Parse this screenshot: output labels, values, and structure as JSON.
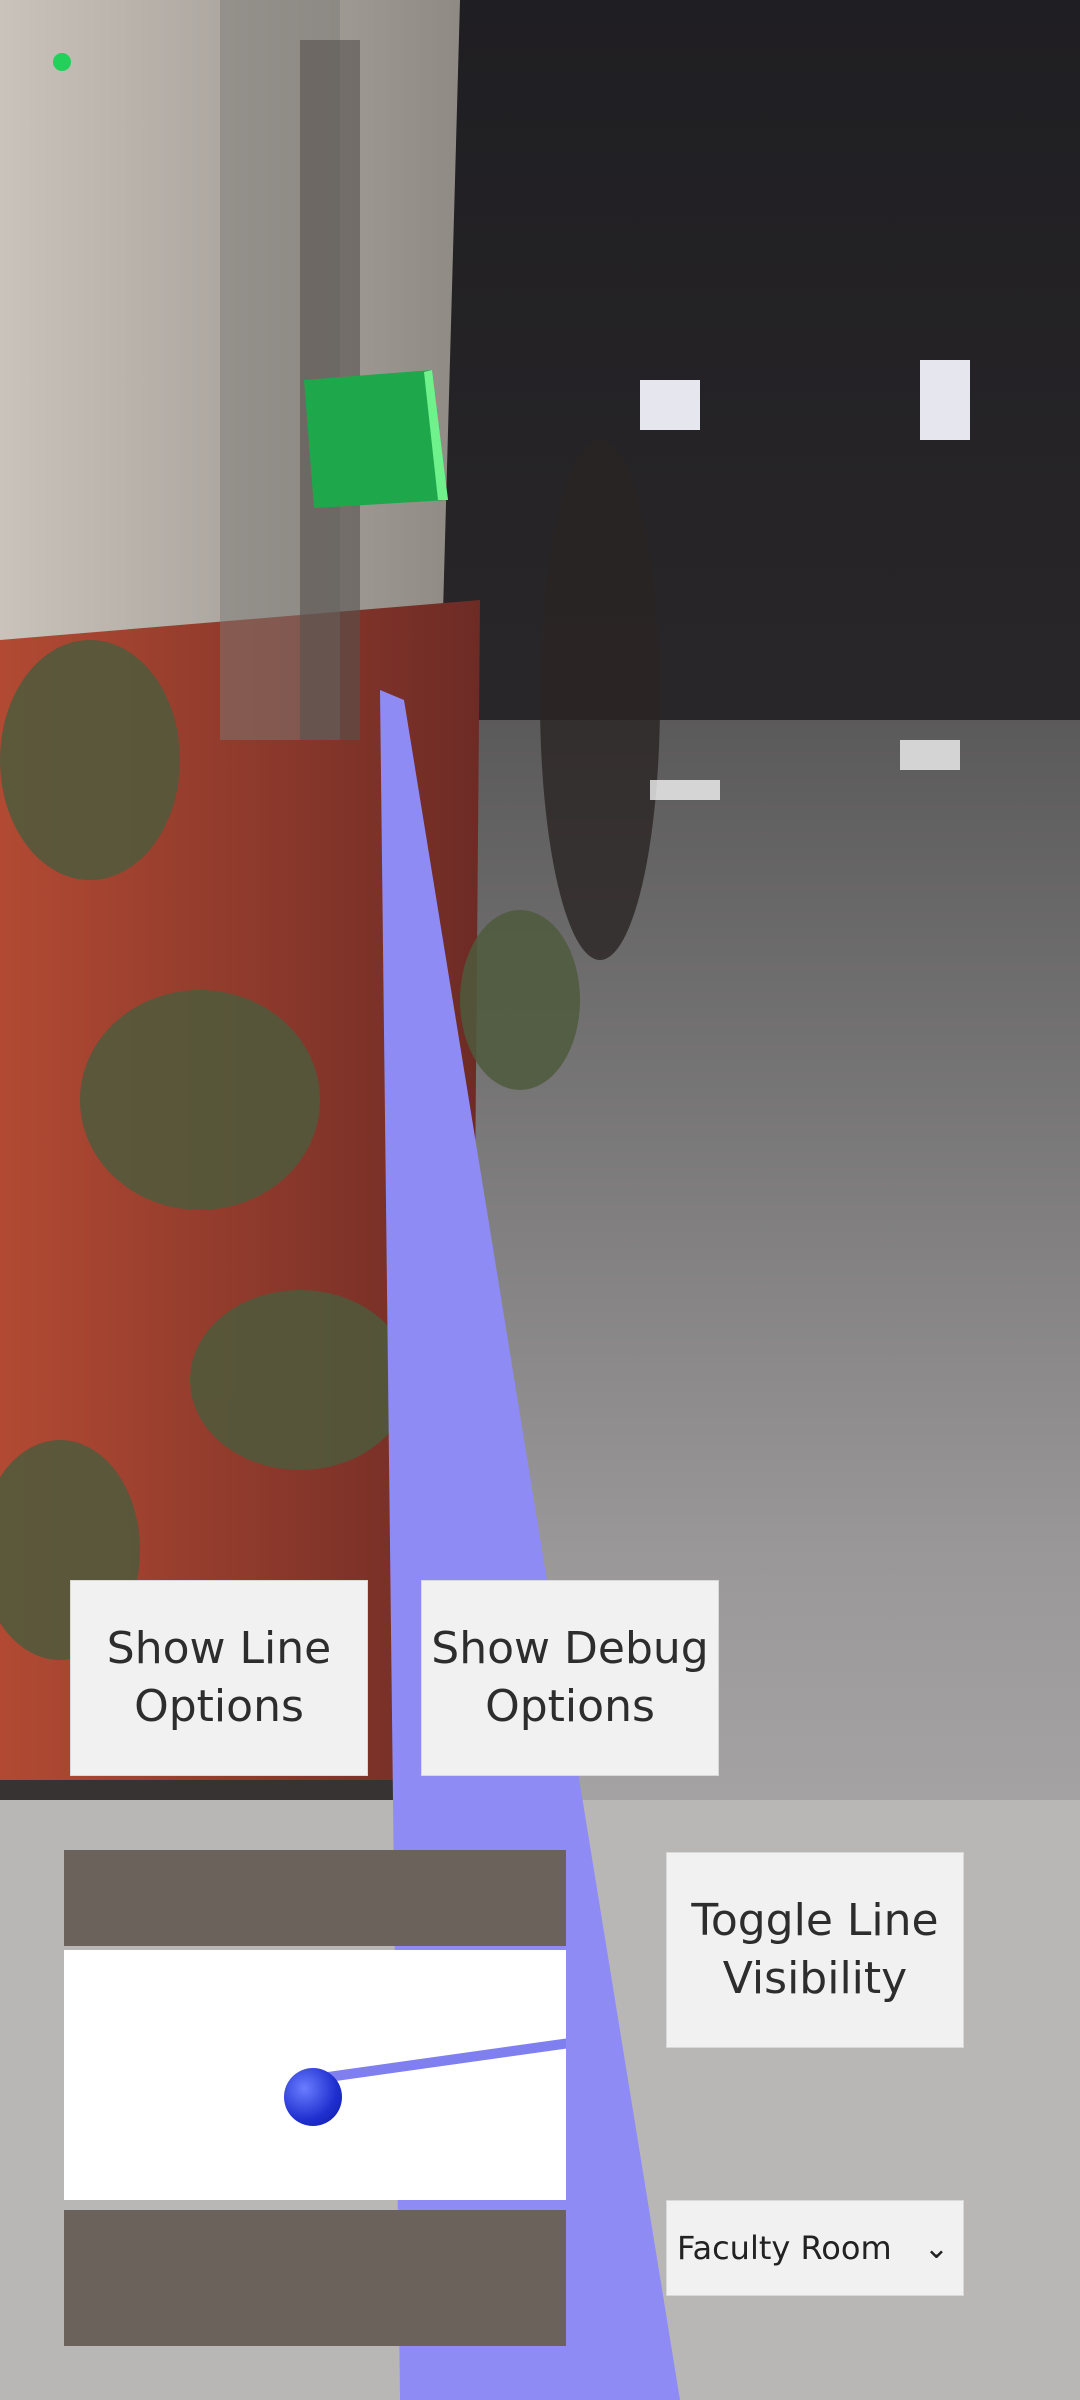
{
  "buttons": {
    "line_options": "Show Line Options",
    "debug_options": "Show Debug Options",
    "toggle_line": "Toggle Line Visibility"
  },
  "destination_select": {
    "selected": "Faculty Room",
    "icon": "chevron-down-icon"
  },
  "ar_markers": {
    "target_cube_icon": "green-cube-icon",
    "status_dot_icon": "green-dot-icon"
  },
  "minimap": {
    "position_marker_icon": "blue-sphere-icon"
  },
  "colors": {
    "path_line": "#8f8bf5",
    "target_cube": "#1fa84b",
    "marker": "#1f2fcf"
  }
}
